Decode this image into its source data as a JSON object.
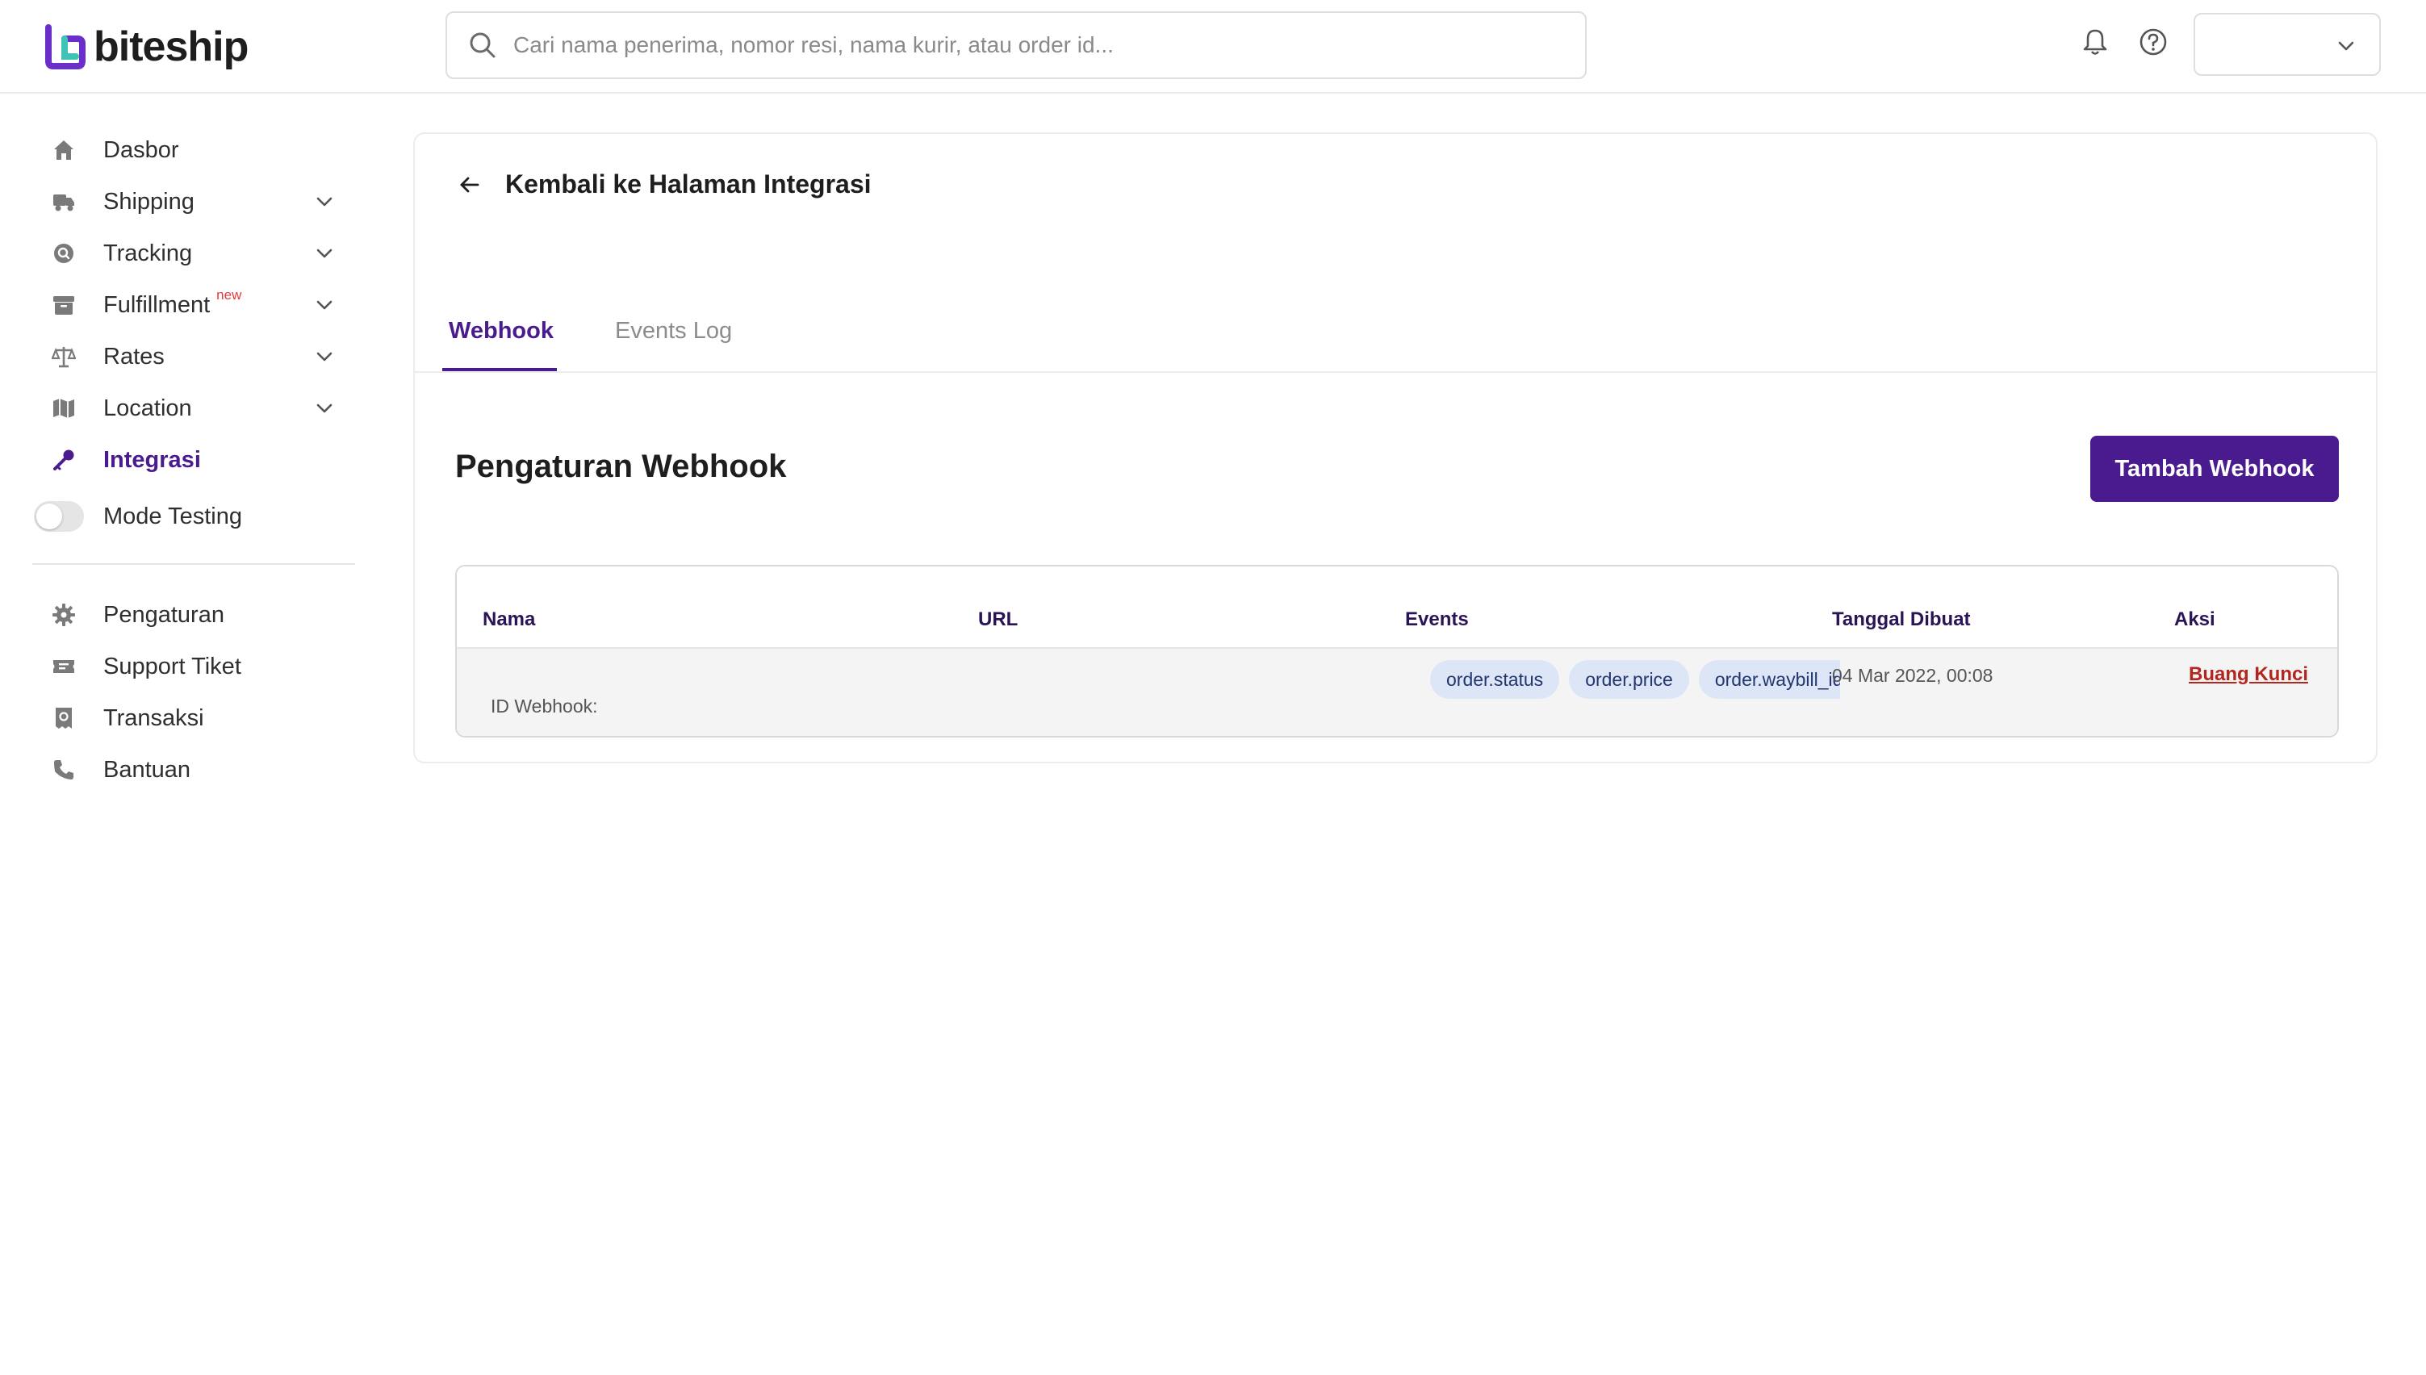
{
  "brand": {
    "name": "biteship"
  },
  "search": {
    "placeholder": "Cari nama penerima, nomor resi, nama kurir, atau order id..."
  },
  "sidebar": {
    "items": [
      {
        "label": "Dasbor",
        "icon": "home-icon"
      },
      {
        "label": "Shipping",
        "icon": "truck-icon"
      },
      {
        "label": "Tracking",
        "icon": "tracking-icon"
      },
      {
        "label": "Fulfillment",
        "icon": "archive-icon",
        "badge": "new"
      },
      {
        "label": "Rates",
        "icon": "scale-icon"
      },
      {
        "label": "Location",
        "icon": "map-icon"
      },
      {
        "label": "Integrasi",
        "icon": "key-icon"
      }
    ],
    "mode_testing": {
      "label": "Mode Testing",
      "on": false
    },
    "secondary": [
      {
        "label": "Pengaturan",
        "icon": "gear-icon"
      },
      {
        "label": "Support Tiket",
        "icon": "ticket-icon"
      },
      {
        "label": "Transaksi",
        "icon": "receipt-icon"
      },
      {
        "label": "Bantuan",
        "icon": "phone-icon"
      }
    ]
  },
  "main": {
    "back_label": "Kembali ke Halaman Integrasi",
    "tabs": [
      {
        "label": "Webhook"
      },
      {
        "label": "Events Log"
      }
    ],
    "section_title": "Pengaturan Webhook",
    "add_button": "Tambah Webhook",
    "table": {
      "headers": [
        "Nama",
        "URL",
        "Events",
        "Tanggal Dibuat",
        "Aksi"
      ],
      "rows": [
        {
          "id_label": "ID Webhook:",
          "events": [
            "order.status",
            "order.price",
            "order.waybill_id"
          ],
          "date": "04 Mar 2022, 00:08",
          "action": "Buang Kunci"
        }
      ]
    }
  },
  "colors": {
    "accent": "#4a1b8f",
    "danger": "#b3261e",
    "chip_bg": "#dde6f7"
  }
}
